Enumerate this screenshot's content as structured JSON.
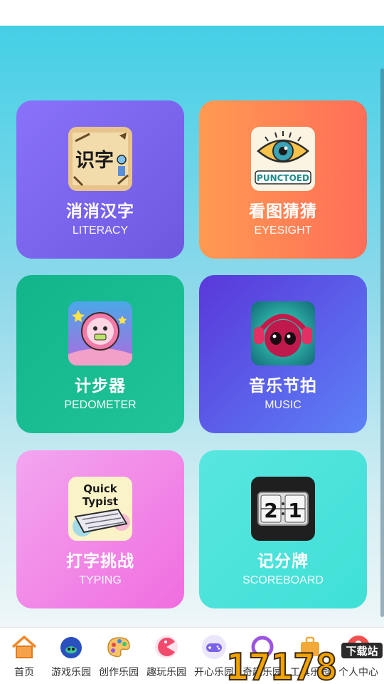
{
  "cards": [
    {
      "title": "消消汉字",
      "subtitle": "LITERACY",
      "icon": "literacy-icon",
      "icon_text": "识字"
    },
    {
      "title": "看图猜猜",
      "subtitle": "EYESIGHT",
      "icon": "eye-icon",
      "icon_text": "PUNCTOED"
    },
    {
      "title": "计步器",
      "subtitle": "PEDOMETER",
      "icon": "pedometer-icon"
    },
    {
      "title": "音乐节拍",
      "subtitle": "MUSIC",
      "icon": "headphones-icon"
    },
    {
      "title": "打字挑战",
      "subtitle": "TYPING",
      "icon": "keyboard-icon",
      "icon_text_1": "Quick",
      "icon_text_2": "Typist"
    },
    {
      "title": "记分牌",
      "subtitle": "SCOREBOARD",
      "icon": "scoreboard-icon",
      "icon_text_left": "2",
      "icon_text_right": "1"
    }
  ],
  "tabbar": {
    "items": [
      {
        "label": "首页",
        "icon": "home-icon",
        "color": "#f08a2c"
      },
      {
        "label": "游戏乐园",
        "icon": "game-icon",
        "color": "#2a4fbf"
      },
      {
        "label": "创作乐园",
        "icon": "palette-icon",
        "color": "#f3b24a"
      },
      {
        "label": "趣玩乐园",
        "icon": "pacman-icon",
        "color": "#f24a6d"
      },
      {
        "label": "开心乐园",
        "icon": "gamepad-icon",
        "color": "#7b62e8"
      },
      {
        "label": "奇趣乐园",
        "icon": "circle-icon",
        "color": "#9b55e0"
      },
      {
        "label": "工具乐园",
        "icon": "briefcase-icon",
        "color": "#f2a93a"
      },
      {
        "label": "个人中心",
        "icon": "user-icon",
        "color": "#f05050"
      }
    ]
  },
  "watermark": {
    "text": "17178",
    "badge": "下载站"
  }
}
